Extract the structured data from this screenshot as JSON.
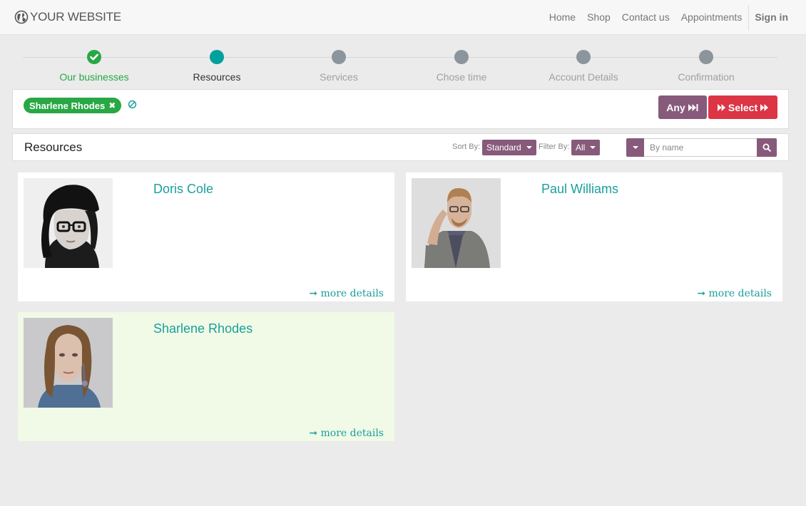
{
  "brand": {
    "name": "YOUR WEBSITE"
  },
  "nav": {
    "items": [
      {
        "label": "Home"
      },
      {
        "label": "Shop"
      },
      {
        "label": "Contact us"
      },
      {
        "label": "Appointments"
      }
    ],
    "sign_in": "Sign in"
  },
  "wizard": {
    "steps": [
      {
        "label": "Our businesses",
        "state": "done"
      },
      {
        "label": "Resources",
        "state": "active"
      },
      {
        "label": "Services",
        "state": "pending"
      },
      {
        "label": "Chose time",
        "state": "pending"
      },
      {
        "label": "Account Details",
        "state": "pending"
      },
      {
        "label": "Confirmation",
        "state": "pending"
      }
    ]
  },
  "selection": {
    "chip_label": "Sharlene Rhodes",
    "any_label": "Any",
    "select_label": "Select"
  },
  "toolbar": {
    "title": "Resources",
    "sort_label": "Sort By:",
    "sort_value": "Standard",
    "filter_label": "Filter By:",
    "filter_value": "All",
    "search_placeholder": "By name"
  },
  "resources": [
    {
      "name": "Doris Cole",
      "more": "more details",
      "selected": false
    },
    {
      "name": "Paul Williams",
      "more": "more details",
      "selected": false
    },
    {
      "name": "Sharlene Rhodes",
      "more": "more details",
      "selected": true
    }
  ],
  "colors": {
    "accent": "#875a7b",
    "danger": "#dc3545",
    "success": "#28a745",
    "teal": "#00a09d"
  }
}
